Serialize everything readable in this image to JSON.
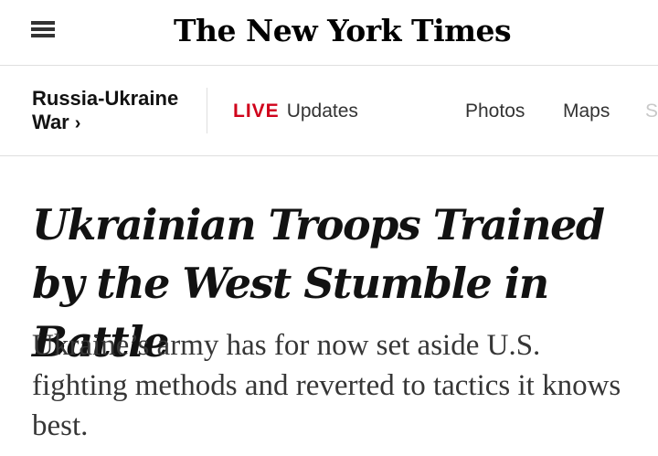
{
  "masthead": {
    "logo_text": "The New York Times",
    "menu_icon": "hamburger-menu-icon"
  },
  "section_bar": {
    "section_title": "Russia-Ukraine War",
    "section_chevron": "›",
    "live_badge": "LIVE",
    "live_label": "Updates",
    "nav_items": [
      "Photos",
      "Maps",
      "S"
    ]
  },
  "article": {
    "headline": "Ukrainian Troops Trained by the West Stumble in Battle",
    "summary": "Ukraine’s army has for now set aside U.S. fighting methods and reverted to tactics it knows best."
  },
  "colors": {
    "live_red": "#d0021b",
    "divider_gray": "#dfdfdf",
    "text_dark": "#121212"
  }
}
